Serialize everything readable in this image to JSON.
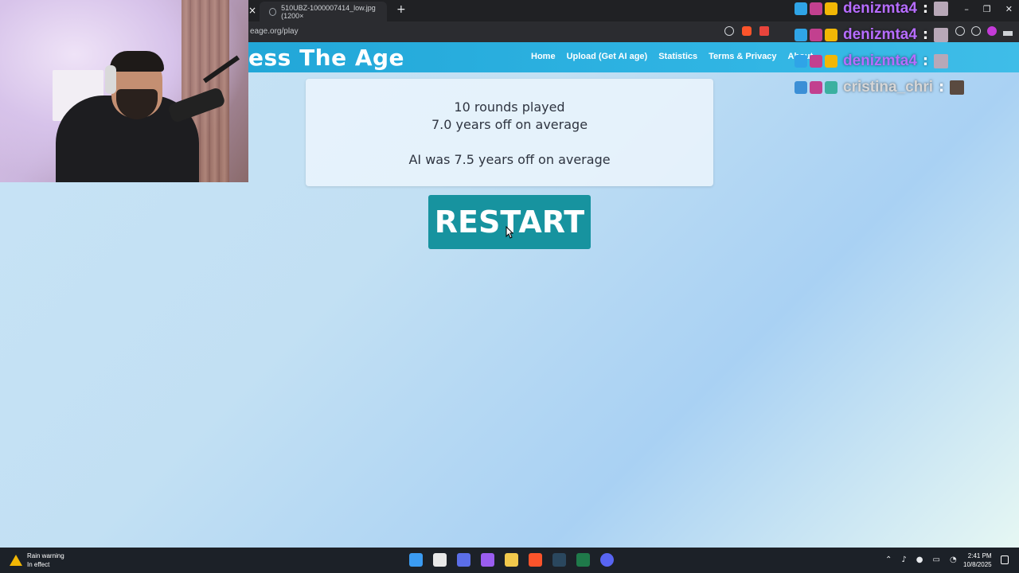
{
  "browser": {
    "tab_title": "510UBZ-1000007414_low.jpg (1200×",
    "prev_tab_close": "×",
    "new_tab": "+",
    "url": "eage.org/play",
    "window_controls": [
      "–",
      "❐",
      "✕"
    ]
  },
  "site": {
    "logo": "ess The Age",
    "nav": [
      "Home",
      "Upload (Get AI age)",
      "Statistics",
      "Terms & Privacy",
      "About"
    ]
  },
  "results": {
    "rounds": "10 rounds played",
    "player_avg": "7.0 years off on average",
    "ai_avg": "AI was 7.5 years off on average"
  },
  "restart_label": "RESTART",
  "chat": [
    {
      "name": "denizmta4",
      "color": "#b66cff",
      "sep": ":"
    },
    {
      "name": "denizmta4",
      "color": "#b66cff",
      "sep": ":"
    },
    {
      "name": "denizmta4",
      "color": "#b66cff",
      "sep": ":"
    },
    {
      "name": "cristina_chri",
      "color": "#d7d7d7",
      "sep": ":"
    }
  ],
  "taskbar": {
    "weather_title": "Rain warning",
    "weather_sub": "In effect",
    "time": "2:41 PM",
    "date": "10/8/2025"
  },
  "colors": {
    "header": "#22a7d8",
    "restart": "#17939f",
    "chat_name": "#b66cff"
  }
}
